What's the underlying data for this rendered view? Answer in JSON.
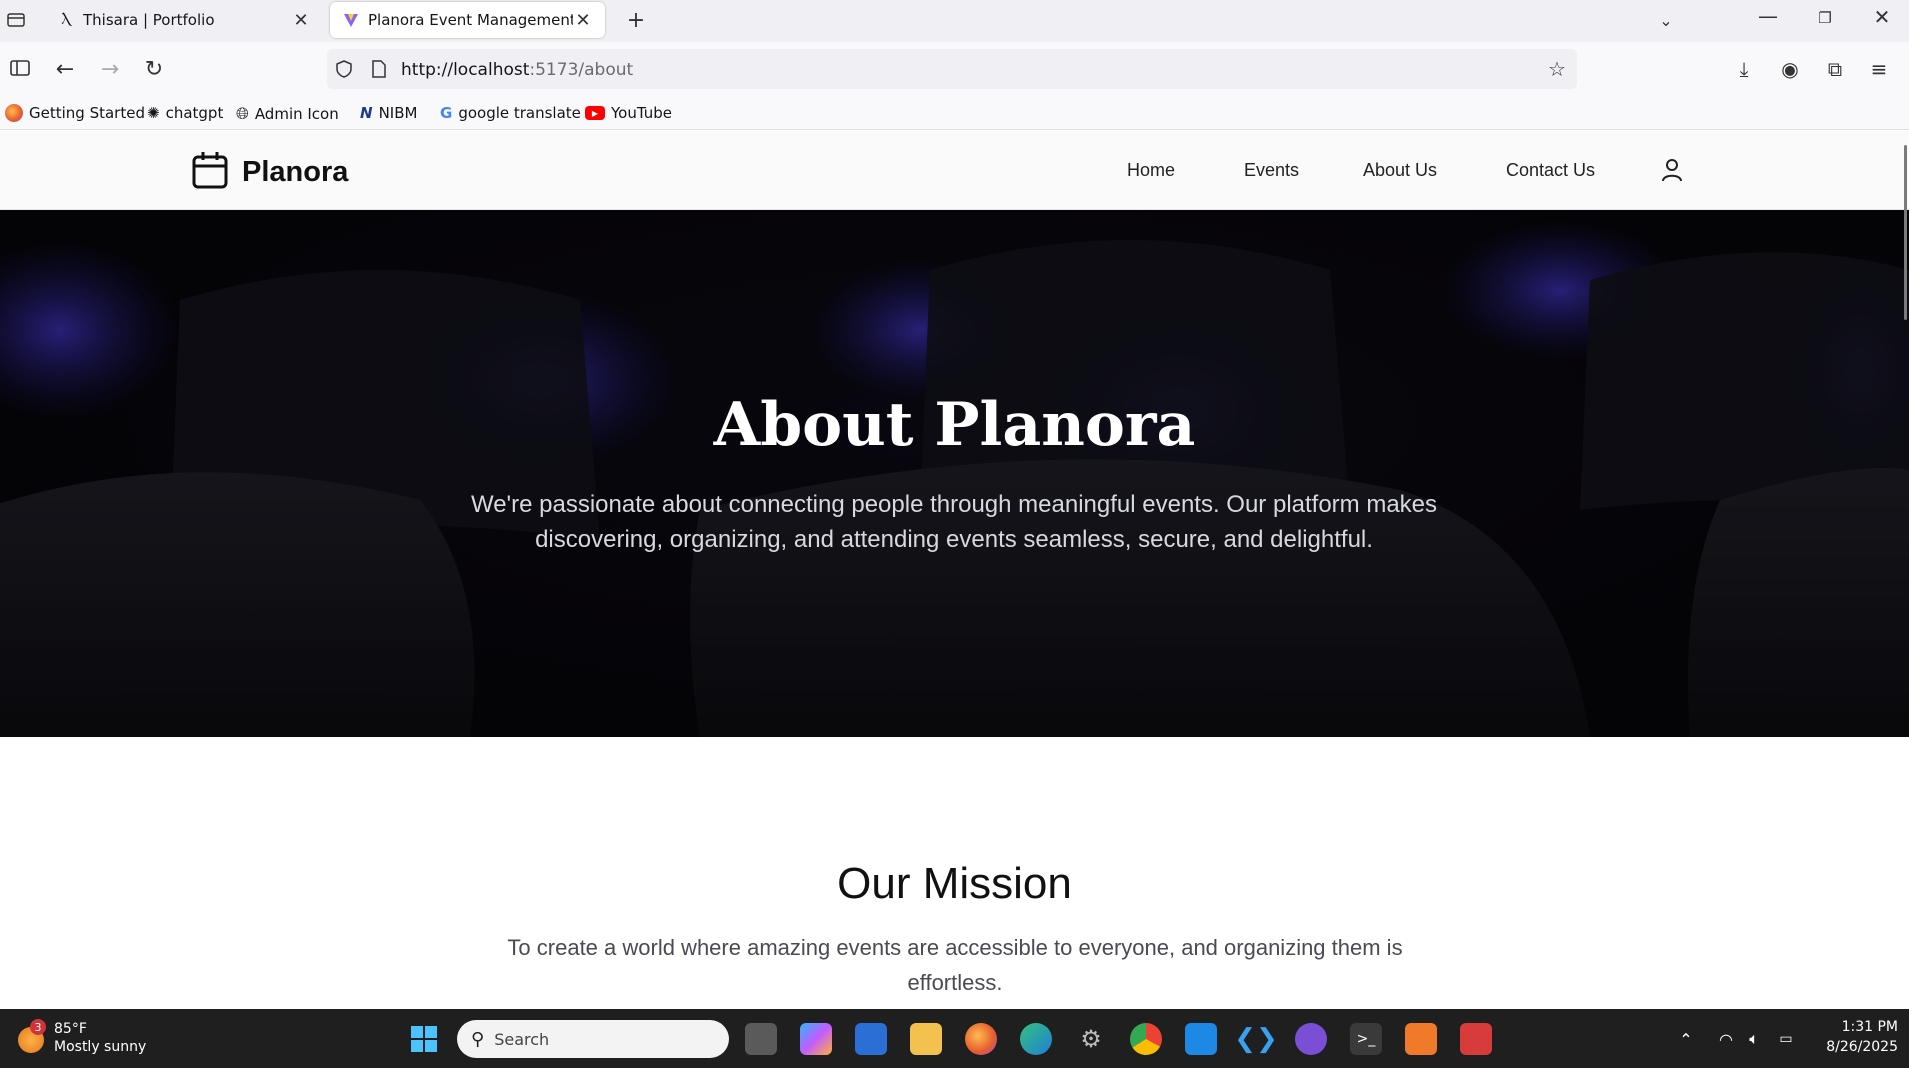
{
  "browser": {
    "tabs": [
      {
        "title": "Thisara | Portfolio"
      },
      {
        "title": "Planora Event Management Plat"
      }
    ],
    "url": {
      "host": "http://localhost",
      "path": ":5173/about"
    },
    "bookmarks": [
      "Getting Started",
      "chatgpt",
      "Admin Icon",
      "NIBM",
      "google translate",
      "YouTube"
    ]
  },
  "site": {
    "brand": "Planora",
    "nav": [
      "Home",
      "Events",
      "About Us",
      "Contact Us"
    ]
  },
  "hero": {
    "title": "About Planora",
    "line1": "We're passionate about connecting people through meaningful events. Our platform makes",
    "line2": "discovering, organizing, and attending events seamless, secure, and delightful."
  },
  "mission": {
    "title": "Our Mission",
    "line1": "To create a world where amazing events are accessible to everyone, and organizing them is",
    "line2": "effortless."
  },
  "taskbar": {
    "weather_badge": "3",
    "temp": "85°F",
    "condition": "Mostly sunny",
    "search_placeholder": "Search",
    "time": "1:31 PM",
    "date": "8/26/2025"
  }
}
